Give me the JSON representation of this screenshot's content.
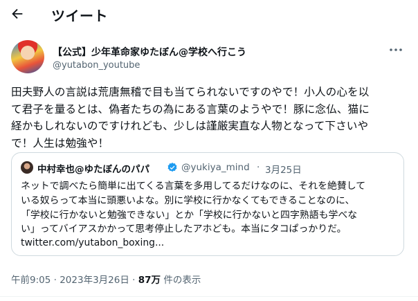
{
  "header": {
    "title": "ツイート"
  },
  "tweet": {
    "author_name": "【公式】少年革命家ゆたぼん@学校へ行こう",
    "author_handle": "@yutabon_youtube",
    "text": "田夫野人の言説は荒唐無稽で目も当てられないですのやで！小人の心を以\nて君子を量るとは、偽者たちの為にある言葉のようやで！豚に念仏、猫に\n経かもしれないのですけれども、少しは謹厳実直な人物となって下さいや\nで！人生は勉強や！",
    "time": "午前9:05",
    "separator": "·",
    "date": "2023年3月26日",
    "views_count": "87万",
    "views_label": "件の表示"
  },
  "quote": {
    "author_name": "中村幸也@ゆたぼんのパパ",
    "author_handle": "@yukiya_mind",
    "separator": "·",
    "date": "3月25日",
    "text": "ネットで調べたら簡単に出てくる言葉を多用してるだけなのに、それを絶賛して\nいる奴らって本当に頭悪いよな。別に学校に行かなくてもできることなのに、\n「学校に行かないと勉強できない」とか「学校に行かないと四字熟語も学べな\nい」ってバイアスかかって思考停止したアホども。本当にタコぱっかりだ。",
    "link": "twitter.com/yutabon_boxing..."
  },
  "colors": {
    "text": "#0f1419",
    "secondary": "#536471",
    "border": "#cfd9de",
    "verified": "#1d9bf0"
  },
  "icons": {
    "back": "arrow-left-icon",
    "more": "more-horizontal-icon",
    "verified": "verified-badge-icon"
  }
}
